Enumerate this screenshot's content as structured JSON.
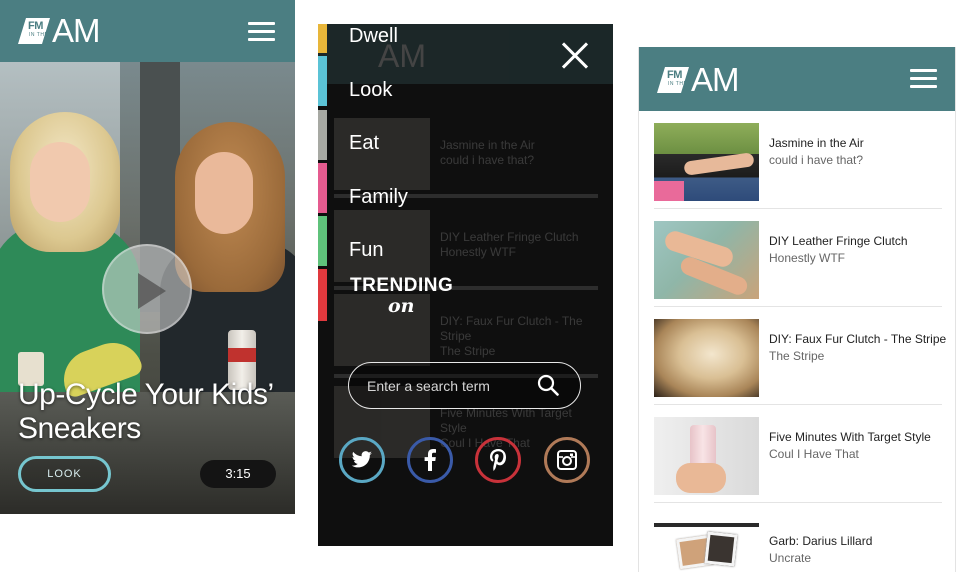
{
  "brand": {
    "fm": "FM",
    "inthe": "IN THE",
    "am": "AM",
    "header_color": "#4b7e82"
  },
  "video_screen": {
    "title": "Up-Cycle Your Kids’ Sneakers",
    "look_button": "LOOK",
    "duration": "3:15",
    "accent_color": "#76c6cf"
  },
  "menu_screen": {
    "items": [
      {
        "label": "Dwell",
        "color": "#e8b63a"
      },
      {
        "label": "Look",
        "color": "#5bc3d6"
      },
      {
        "label": "Eat",
        "color": "#a7a9a3"
      },
      {
        "label": "Family",
        "color": "#e55b8f"
      },
      {
        "label": "Fun",
        "color": "#5fc27b"
      },
      {
        "label": "",
        "color": "#e0393e"
      }
    ],
    "trending_line1": "TRENDING",
    "trending_line2": "on",
    "search_placeholder": "Enter a search term",
    "social": [
      {
        "name": "twitter-icon",
        "color": "#5aa8c4"
      },
      {
        "name": "facebook-icon",
        "color": "#3a5aa8"
      },
      {
        "name": "pinterest-icon",
        "color": "#c8323a"
      },
      {
        "name": "instagram-icon",
        "color": "#b07a58"
      }
    ],
    "under_titles": [
      {
        "title": "Jasmine in the Air",
        "sub": "could i have that?"
      },
      {
        "title": "DIY Leather Fringe Clutch",
        "sub": "Honestly WTF"
      },
      {
        "title": "DIY: Faux Fur Clutch - The Stripe",
        "sub": "The Stripe"
      },
      {
        "title": "Five Minutes With Target Style",
        "sub": "Coul I Have That"
      }
    ]
  },
  "list_screen": {
    "articles": [
      {
        "title": "Jasmine in the Air",
        "source": "could i have that?"
      },
      {
        "title": "DIY Leather Fringe Clutch",
        "source": "Honestly WTF"
      },
      {
        "title": "DIY: Faux Fur Clutch - The Stripe",
        "source": "The Stripe"
      },
      {
        "title": "Five Minutes With Target Style",
        "source": "Coul I Have That"
      },
      {
        "title": "Garb: Darius Lillard",
        "source": "Uncrate"
      }
    ]
  }
}
